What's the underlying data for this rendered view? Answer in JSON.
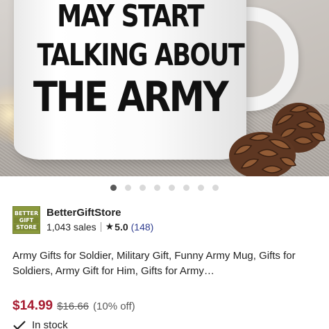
{
  "hero": {
    "mug_text": [
      "MAY START",
      "TALKING ABOUT",
      "THE ARMY"
    ],
    "icon": "product-photo"
  },
  "carousel": {
    "count": 8,
    "active_index": 0
  },
  "shop": {
    "logo_lines": [
      "BETTER",
      "GIFT",
      "STORE"
    ],
    "name": "BetterGiftStore",
    "sales": "1,043 sales",
    "star": "★",
    "rating": "5.0",
    "reviews": "(148)"
  },
  "listing": {
    "title": "Army Gifts for Soldier, Military Gift, Funny Army Mug, Gifts for Soldiers, Army Gift for Him, Gifts for Army…",
    "price": "$14.99",
    "original_price": "$16.66",
    "discount": "(10% off)",
    "stock": "In stock"
  },
  "colors": {
    "price": "#a61a2f",
    "review_link": "#2f3d8f",
    "logo_bg": "#8b9a3c",
    "dot_active": "#595959",
    "dot_inactive": "#d9d9d9"
  }
}
